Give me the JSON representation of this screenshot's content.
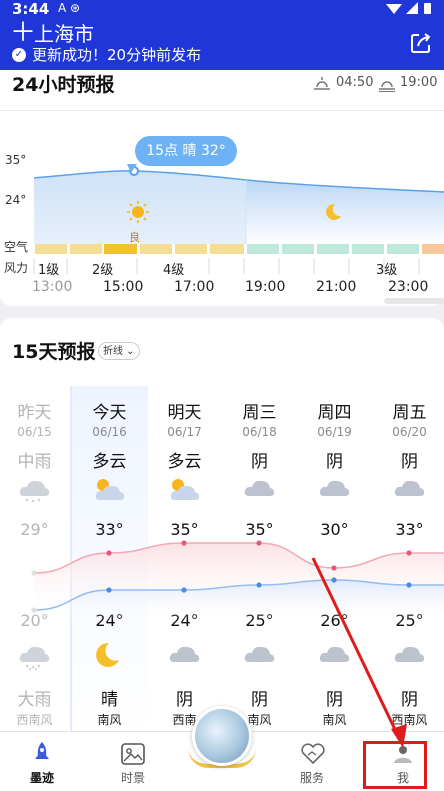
{
  "status_bar": {
    "time": "3:44",
    "icons": "A ⊛"
  },
  "header": {
    "add_icon": "plus-icon",
    "city": "上海市",
    "update_status": "更新成功！20分钟前发布",
    "share_icon": "share-icon",
    "bg_color": "#1f36d8"
  },
  "hourly": {
    "title": "24小时预报",
    "sunrise": "04:50",
    "sunset": "19:00",
    "y_labels": [
      "35°",
      "24°"
    ],
    "air_label": "空气",
    "wind_label": "风力",
    "tooltip": "15点 晴 32°",
    "aqi_tag": "良",
    "wind_levels": [
      "1级",
      "2级",
      "4级",
      "3级"
    ],
    "times": [
      "13:00",
      "15:00",
      "17:00",
      "19:00",
      "21:00",
      "23:00"
    ],
    "icons": [
      "sun-icon",
      "moon-icon"
    ]
  },
  "daily": {
    "title": "15天预报",
    "toggle_label": "折线",
    "days": [
      {
        "weekday": "昨天",
        "date": "06/15",
        "day_weather": "中雨",
        "high": "29°",
        "low": "20°",
        "night_weather": "大雨",
        "wind": "西南风",
        "day_icon": "rain-cloud-icon",
        "night_icon": "heavy-rain-icon"
      },
      {
        "weekday": "今天",
        "date": "06/16",
        "day_weather": "多云",
        "high": "33°",
        "low": "24°",
        "night_weather": "晴",
        "wind": "南风",
        "day_icon": "partly-cloudy-icon",
        "night_icon": "moon-icon"
      },
      {
        "weekday": "明天",
        "date": "06/17",
        "day_weather": "多云",
        "high": "35°",
        "low": "24°",
        "night_weather": "阴",
        "wind": "西南",
        "day_icon": "partly-cloudy-icon",
        "night_icon": "cloud-icon"
      },
      {
        "weekday": "周三",
        "date": "06/18",
        "day_weather": "阴",
        "high": "35°",
        "low": "25°",
        "night_weather": "阴",
        "wind": "南风",
        "day_icon": "cloud-icon",
        "night_icon": "cloud-icon"
      },
      {
        "weekday": "周四",
        "date": "06/19",
        "day_weather": "阴",
        "high": "30°",
        "low": "26°",
        "night_weather": "阴",
        "wind": "南风",
        "day_icon": "cloud-icon",
        "night_icon": "cloud-icon"
      },
      {
        "weekday": "周五",
        "date": "06/20",
        "day_weather": "阴",
        "high": "33°",
        "low": "25°",
        "night_weather": "阴",
        "wind": "西南风",
        "day_icon": "cloud-icon",
        "night_icon": "cloud-icon"
      }
    ],
    "high_color": "#f0a9b4",
    "low_color": "#94bdf0"
  },
  "nav": {
    "items": [
      {
        "label": "墨迹",
        "icon": "rocket-icon"
      },
      {
        "label": "时景",
        "icon": "image-icon"
      },
      {
        "label": "服务",
        "icon": "heart-hands-icon"
      },
      {
        "label": "我",
        "icon": "profile-icon"
      }
    ]
  },
  "chart_data": [
    {
      "type": "line",
      "title": "24小时预报",
      "x": [
        "13:00",
        "15:00",
        "17:00",
        "19:00",
        "21:00",
        "23:00"
      ],
      "series": [
        {
          "values": [
            31,
            32,
            31,
            29,
            28,
            27
          ]
        }
      ],
      "y_ticks": [
        "35°",
        "24°"
      ]
    },
    {
      "type": "line",
      "title": "15天预报",
      "categories": [
        "06/15",
        "06/16",
        "06/17",
        "06/18",
        "06/19",
        "06/20"
      ],
      "series": [
        {
          "values": [
            29,
            33,
            35,
            35,
            30,
            33
          ]
        },
        {
          "values": [
            20,
            24,
            24,
            25,
            26,
            25
          ]
        }
      ]
    }
  ]
}
